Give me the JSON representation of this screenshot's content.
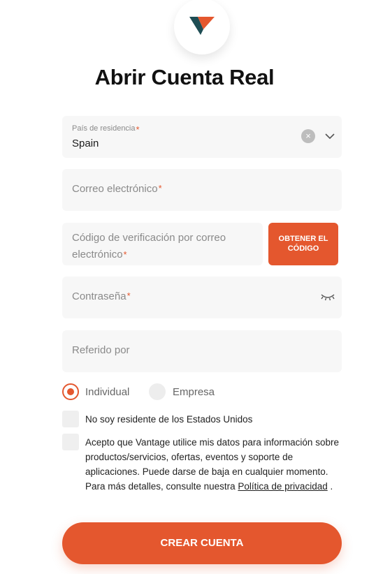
{
  "brand": {
    "logo": "vantage-v-logo",
    "colors": {
      "accent": "#e4572e",
      "teal": "#1e4d54"
    }
  },
  "title": "Abrir Cuenta Real",
  "form": {
    "country": {
      "label": "País de residencia",
      "required_mark": "*",
      "value": "Spain",
      "clear_icon": "×"
    },
    "email": {
      "placeholder": "Correo electrónico",
      "required_mark": "*"
    },
    "verification": {
      "placeholder": "Código de verificación por correo electrónico",
      "required_mark": "*",
      "button_label": "OBTENER EL CÓDIGO"
    },
    "password": {
      "placeholder": "Contraseña",
      "required_mark": "*"
    },
    "referral": {
      "placeholder": "Referido por"
    },
    "account_type": {
      "options": [
        {
          "label": "Individual",
          "selected": true
        },
        {
          "label": "Empresa",
          "selected": false
        }
      ]
    },
    "checkboxes": {
      "non_us": {
        "label": "No soy residente de los Estados Unidos",
        "checked": false
      },
      "consent": {
        "label": "Acepto que Vantage utilice mis datos para información sobre productos/servicios, ofertas, eventos y soporte de aplicaciones. Puede darse de baja en cualquier momento. Para más detalles, consulte nuestra",
        "link_text": "Política de privacidad",
        "suffix": ".",
        "checked": false
      }
    },
    "submit_label": "CREAR CUENTA"
  }
}
